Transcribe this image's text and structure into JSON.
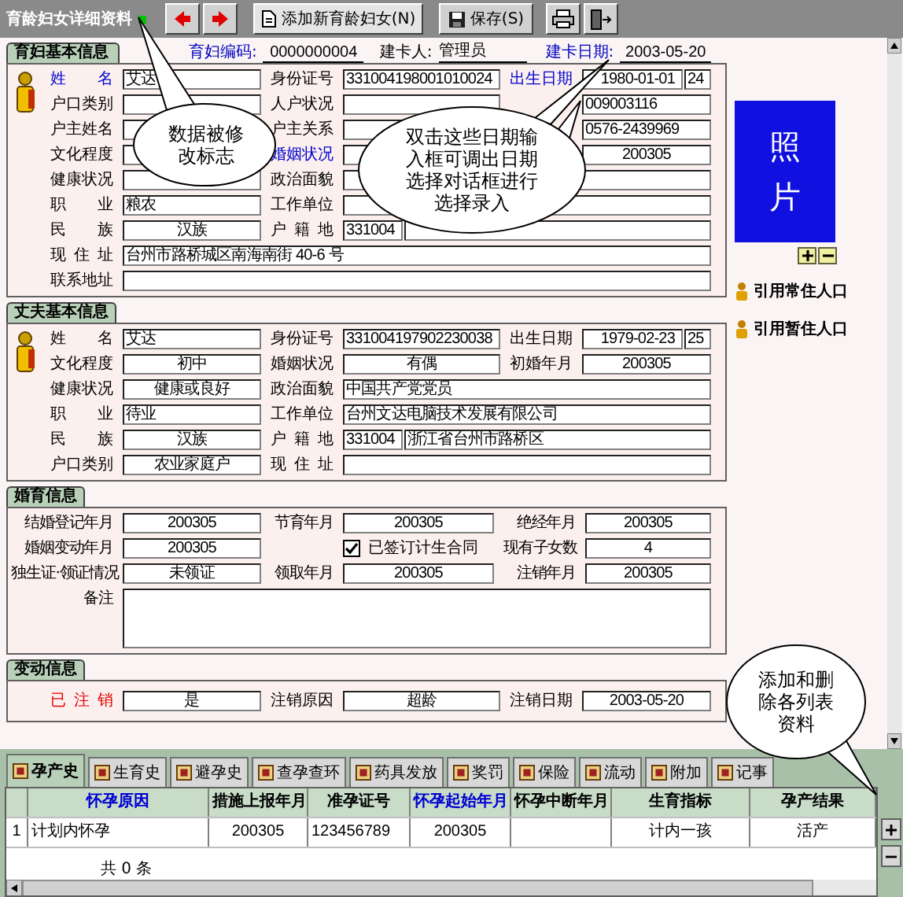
{
  "toolbar": {
    "title": "育龄妇女详细资料",
    "modified": true,
    "add_button": "添加新育龄妇女(N)",
    "save_button": "保存(S)"
  },
  "woman": {
    "tab": "育妇基本信息",
    "code_label": "育妇编码:",
    "code": "0000000004",
    "creator_label": "建卡人:",
    "creator": "管理员",
    "date_label": "建卡日期:",
    "date": "2003-05-20",
    "rows": [
      [
        {
          "label": "姓名",
          "required": true,
          "kind": "text",
          "value": "艾达"
        },
        {
          "label": "身份证号",
          "required": false,
          "kind": "text",
          "value": "331004198001010024"
        },
        {
          "label": "出生日期",
          "required": true,
          "kind": "age",
          "value": "1980-01-01",
          "extra": "24"
        }
      ],
      [
        {
          "label": "户口类别",
          "required": false,
          "kind": "center"
        },
        {
          "label": "人户状况",
          "required": false,
          "kind": "center"
        },
        {
          "kind": "text",
          "value": "009003116"
        }
      ],
      [
        {
          "label": "户主姓名",
          "required": false,
          "kind": "text"
        },
        {
          "label": "户主关系",
          "required": false,
          "kind": "text"
        },
        {
          "kind": "text",
          "value": "0576-2439969"
        }
      ],
      [
        {
          "label": "文化程度",
          "required": false,
          "kind": "center"
        },
        {
          "label": "婚姻状况",
          "required": true,
          "kind": "center"
        },
        {
          "kind": "center",
          "value": "200305"
        }
      ],
      [
        {
          "label": "健康状况",
          "required": false,
          "kind": "center"
        },
        {
          "label": "政治面貌",
          "required": false,
          "kind": "wide"
        }
      ],
      [
        {
          "label": "职业",
          "required": false,
          "kind": "text",
          "value": "粮农"
        },
        {
          "label": "工作单位",
          "required": false,
          "kind": "wide"
        }
      ],
      [
        {
          "label": "民族",
          "required": false,
          "kind": "center",
          "value": "汉族"
        },
        {
          "label": "户籍地",
          "required": false,
          "kind": "region",
          "extra": "331004"
        }
      ],
      [
        {
          "label": "现住址",
          "required": false,
          "kind": "wide",
          "value": "台州市路桥城区南海南街 40-6 号"
        }
      ],
      [
        {
          "label": "联系地址",
          "required": false,
          "kind": "wide"
        }
      ]
    ]
  },
  "photo": {
    "label": "照片"
  },
  "refs": [
    "引用常住人口",
    "引用暂住人口"
  ],
  "husband": {
    "tab": "丈夫基本信息",
    "rows": [
      [
        {
          "label": "姓名",
          "kind": "text",
          "value": "艾达"
        },
        {
          "label": "身份证号",
          "kind": "text",
          "value": "331004197902230038"
        },
        {
          "label": "出生日期",
          "kind": "age",
          "value": "1979-02-23",
          "extra": "25"
        }
      ],
      [
        {
          "label": "文化程度",
          "kind": "center",
          "value": "初中"
        },
        {
          "label": "婚姻状况",
          "kind": "center",
          "value": "有偶"
        },
        {
          "label": "初婚年月",
          "kind": "center",
          "value": "200305"
        }
      ],
      [
        {
          "label": "健康状况",
          "kind": "center",
          "value": "健康或良好"
        },
        {
          "label": "政治面貌",
          "kind": "wide",
          "value": "中国共产党党员"
        }
      ],
      [
        {
          "label": "职业",
          "kind": "text",
          "value": "待业"
        },
        {
          "label": "工作单位",
          "kind": "wide",
          "value": "台州文达电脑技术发展有限公司"
        }
      ],
      [
        {
          "label": "民族",
          "kind": "center",
          "value": "汉族"
        },
        {
          "label": "户籍地",
          "kind": "region",
          "extra": "331004",
          "value": "浙江省台州市路桥区"
        }
      ],
      [
        {
          "label": "户口类别",
          "kind": "center",
          "value": "农业家庭户"
        },
        {
          "label": "现住址",
          "kind": "wide"
        }
      ]
    ]
  },
  "marriage": {
    "tab": "婚育信息",
    "rows": [
      [
        {
          "label": "结婚登记年月",
          "kind": "center",
          "value": "200305"
        },
        {
          "label": "节育年月",
          "kind": "center",
          "value": "200305"
        },
        {
          "label": "绝经年月",
          "kind": "center",
          "value": "200305"
        }
      ],
      [
        {
          "label": "婚姻变动年月",
          "kind": "center",
          "value": "200305"
        },
        {
          "kind": "checkbox",
          "checked": true,
          "value": "已签订计生合同"
        },
        {
          "label": "现有子女数",
          "kind": "center",
          "value": "4"
        }
      ],
      [
        {
          "label": "独生证·领证情况",
          "kind": "center",
          "value": "未领证"
        },
        {
          "label": "领取年月",
          "kind": "center",
          "value": "200305"
        },
        {
          "label": "注销年月",
          "kind": "center",
          "value": "200305"
        }
      ],
      [
        {
          "label": "备注",
          "kind": "textarea"
        }
      ]
    ]
  },
  "change": {
    "tab": "变动信息",
    "rows": [
      [
        {
          "label": "已注销",
          "warning": true,
          "kind": "center",
          "value": "是"
        },
        {
          "label": "注销原因",
          "warning": false,
          "kind": "center",
          "value": "超龄"
        },
        {
          "label": "注销日期",
          "warning": false,
          "kind": "center",
          "value": "2003-05-20"
        }
      ]
    ]
  },
  "record_tabs": [
    {
      "label": "孕产史",
      "selected": true
    },
    {
      "label": "生育史",
      "selected": false
    },
    {
      "label": "避孕史",
      "selected": false
    },
    {
      "label": "查孕查环",
      "selected": false
    },
    {
      "label": "药具发放",
      "selected": false
    },
    {
      "label": "奖罚",
      "selected": false
    },
    {
      "label": "保险",
      "selected": false
    },
    {
      "label": "流动",
      "selected": false
    },
    {
      "label": "附加",
      "selected": false
    },
    {
      "label": "记事",
      "selected": false
    }
  ],
  "table": {
    "columns": [
      {
        "label": "怀孕原因",
        "required": true
      },
      {
        "label": "措施上报年月",
        "required": false
      },
      {
        "label": "准孕证号",
        "required": false
      },
      {
        "label": "怀孕起始年月",
        "required": true
      },
      {
        "label": "怀孕中断年月",
        "required": false
      },
      {
        "label": "生育指标",
        "required": false
      },
      {
        "label": "孕产结果",
        "required": false
      }
    ],
    "rows": [
      {
        "index": "1",
        "cells": [
          "计划内怀孕",
          "200305",
          "123456789",
          "200305",
          null,
          "计内一孩",
          "活产"
        ]
      }
    ],
    "footer": "共 0 条"
  },
  "callouts": [
    {
      "text": "数据被修改标志"
    },
    {
      "text": "双击这些日期输入框可调出日期选择对话框进行选择录入"
    },
    {
      "text": "添加和删除各列表资料"
    }
  ]
}
